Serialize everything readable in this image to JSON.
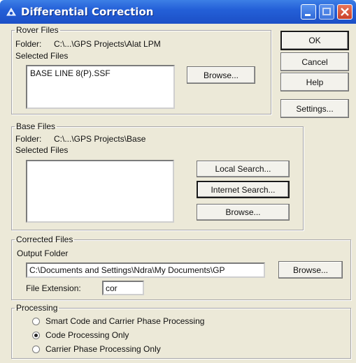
{
  "window": {
    "title": "Differential Correction"
  },
  "rover": {
    "group_label": "Rover Files",
    "folder_label": "Folder:",
    "folder_value": "C:\\...\\GPS Projects\\Alat LPM",
    "selected_label": "Selected Files",
    "files": [
      "BASE LINE 8(P).SSF"
    ],
    "browse_label": "Browse..."
  },
  "base": {
    "group_label": "Base Files",
    "folder_label": "Folder:",
    "folder_value": "C:\\...\\GPS Projects\\Base",
    "selected_label": "Selected Files",
    "local_search_label": "Local Search...",
    "internet_search_label": "Internet Search...",
    "browse_label": "Browse..."
  },
  "corrected": {
    "group_label": "Corrected Files",
    "output_folder_label": "Output Folder",
    "output_folder_value": "C:\\Documents and Settings\\Ndra\\My Documents\\GP",
    "browse_label": "Browse...",
    "extension_label": "File Extension:",
    "extension_value": "cor"
  },
  "processing": {
    "group_label": "Processing",
    "options": [
      {
        "label": "Smart Code and Carrier Phase Processing",
        "selected": false
      },
      {
        "label": "Code Processing Only",
        "selected": true
      },
      {
        "label": "Carrier Phase Processing Only",
        "selected": false
      }
    ]
  },
  "side_buttons": {
    "ok": "OK",
    "cancel": "Cancel",
    "help": "Help",
    "settings": "Settings..."
  },
  "colors": {
    "titlebar": "#2460d8",
    "dialog_bg": "#ece9d8"
  }
}
